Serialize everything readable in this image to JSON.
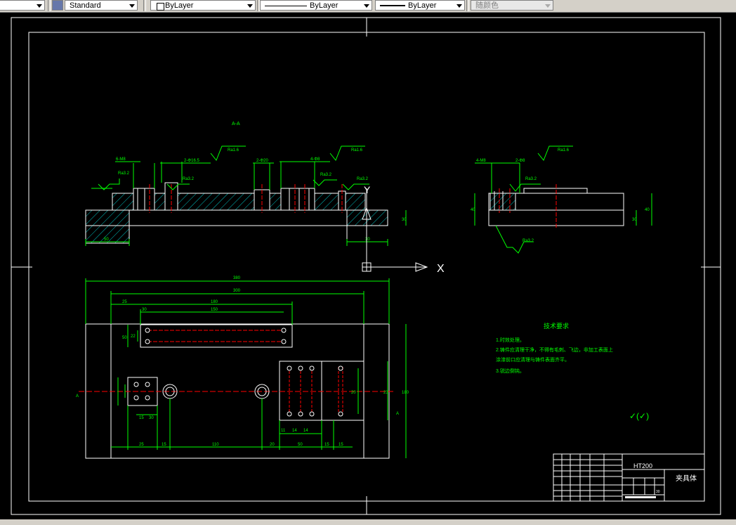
{
  "toolbar": {
    "text_style": "Standard",
    "layer_color": "ByLayer",
    "linetype": "ByLayer",
    "lineweight": "ByLayer",
    "plot_style": "随颜色"
  },
  "drawing": {
    "section_label": "A-A",
    "roughness_labels": [
      "Ra1.6",
      "Ra3.2",
      "Ra3.2",
      "Ra1.6",
      "Ra3.2",
      "Ra3.2",
      "Ra1.6",
      "Ra3.2",
      "Ra3.2"
    ],
    "dims_top": [
      "6-M8",
      "2-Φ16.5",
      "2-Φ20",
      "4-Φ8",
      "4-M8",
      "2-Φ8"
    ],
    "dims_bottom": [
      "50",
      "50",
      "30",
      "40",
      "30"
    ],
    "dims_plan": [
      "380",
      "300",
      "180",
      "150",
      "30",
      "25",
      "50",
      "22",
      "25",
      "25",
      "110",
      "20",
      "50",
      "15",
      "15",
      "11",
      "14",
      "14",
      "15",
      "30",
      "180",
      "20",
      "23"
    ],
    "axis_y": "Y",
    "axis_x": "X",
    "tech_title": "技术要求",
    "tech_lines": [
      "1.时效处理。",
      "2.铸件应清理干净，不得有毛刺、飞边，非加工表面上",
      "涂漆前口应清理与铸件表面齐平。",
      "3.锐边倒钝。"
    ],
    "roughness_other": "✓(✓)"
  },
  "title_block": {
    "material": "HT200",
    "part_name": "夹具体",
    "scale": "30"
  },
  "colors": {
    "green": "#00ff00",
    "white": "#ffffff",
    "red": "#ff0000",
    "cyan": "#00c0c0"
  }
}
